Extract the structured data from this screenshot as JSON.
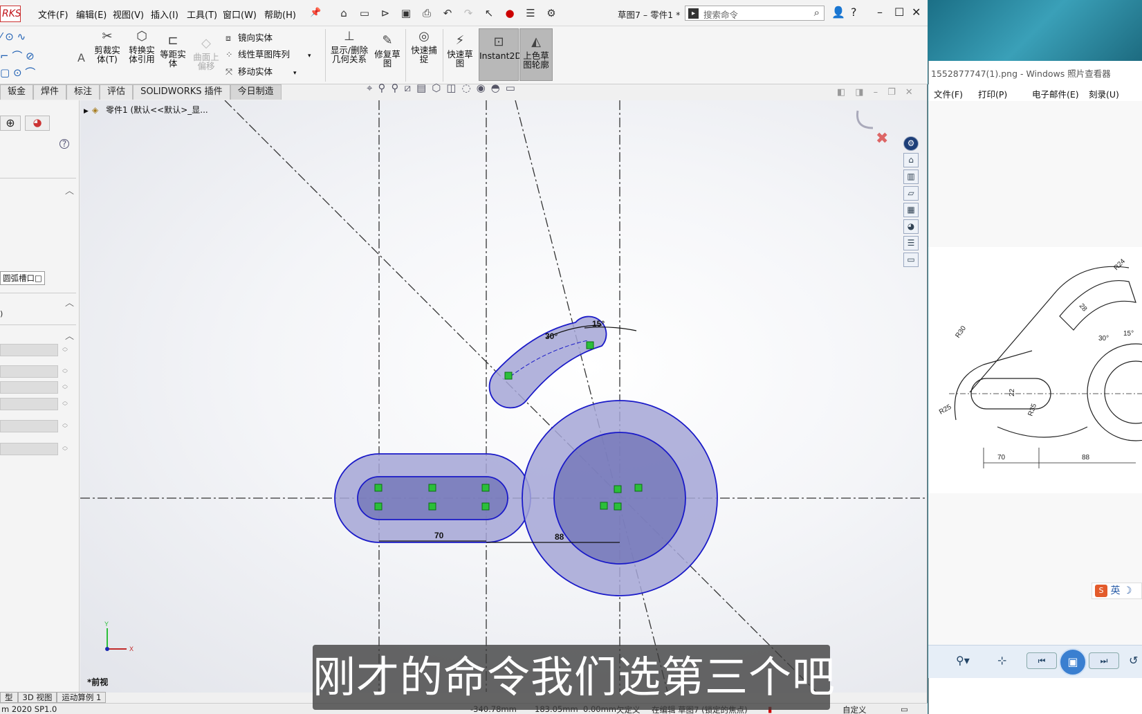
{
  "app": {
    "logo": "RKS",
    "menus": [
      "文件(F)",
      "编辑(E)",
      "视图(V)",
      "插入(I)",
      "工具(T)",
      "窗口(W)",
      "帮助(H)"
    ],
    "doc_title": "草图7 – 零件1 *",
    "search_placeholder": "搜索命令"
  },
  "ribbon": {
    "buttons": {
      "trim": "剪裁实\n体(T)",
      "convert": "转换实\n体引用",
      "offset": "等距实\n体",
      "surface_offset": "曲面上\n偏移",
      "display_relations": "显示/删除\n几何关系",
      "repair": "修复草\n图",
      "quick_snap": "快速捕\n捉",
      "rapid_sketch": "快速草\n图",
      "instant2d": "Instant2D",
      "shaded_contour": "上色草\n图轮廓"
    },
    "small": {
      "mirror": "镜向实体",
      "linear_pattern": "线性草图阵列",
      "move": "移动实体"
    }
  },
  "tabs": [
    "钣金",
    "焊件",
    "标注",
    "评估",
    "SOLIDWORKS 插件",
    "今日制造"
  ],
  "feature_tree": {
    "root": "零件1  (默认<<默认>_显..."
  },
  "left_panel": {
    "tooltip": "圆弧槽口",
    "label_paren": ")"
  },
  "viewport": {
    "view_label": "*前视",
    "axis_x": "X",
    "axis_y": "Y",
    "dimensions": {
      "d70": "70",
      "d88": "88",
      "a30": "30°",
      "a15": "15°"
    }
  },
  "bottom_tabs": [
    "型",
    "3D 视图",
    "运动算例 1"
  ],
  "status": {
    "version": "m 2020 SP1.0",
    "x": "-340.78mm",
    "y": "183.05mm",
    "z": "0.00mm",
    "state": "欠定义",
    "editing": "在编辑 草图7 (锁定的焦点)",
    "custom": "自定义"
  },
  "subtitle": "刚才的命令我们选第三个吧",
  "photo_viewer": {
    "title": "1552877747(1).png - Windows 照片查看器",
    "menus": [
      "文件(F)",
      "打印(P)",
      "电子邮件(E)",
      "刻录(U)"
    ],
    "drawing_labels": {
      "r24": "R24",
      "r28": "28",
      "r30": "R30",
      "d22": "22",
      "r25": "R25",
      "r35": "R35",
      "a30": "30°",
      "a15": "15°",
      "d70": "70",
      "d88": "88"
    }
  },
  "ime": {
    "label": "英"
  }
}
